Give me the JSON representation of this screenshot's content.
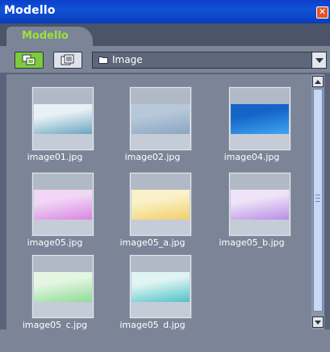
{
  "window": {
    "title": "Modello",
    "close_glyph": "✕"
  },
  "tab": {
    "label": "Modello"
  },
  "toolbar": {
    "view_thumbnails_icon": "thumbnail-view-icon",
    "view_list_icon": "film-view-icon",
    "folder": {
      "icon": "folder-icon",
      "label": "Image"
    }
  },
  "items": [
    {
      "name": "image01.jpg",
      "colors": [
        "#e8f1f5",
        "#6aa6bf"
      ]
    },
    {
      "name": "image02.jpg",
      "colors": [
        "#b7c8da",
        "#8ba6c3"
      ]
    },
    {
      "name": "image04.jpg",
      "colors": [
        "#1565c8",
        "#3fa6ee"
      ]
    },
    {
      "name": "image05.jpg",
      "colors": [
        "#f1d7f5",
        "#d886e3"
      ]
    },
    {
      "name": "image05_a.jpg",
      "colors": [
        "#fbf1c9",
        "#f0d06a"
      ]
    },
    {
      "name": "image05_b.jpg",
      "colors": [
        "#eee3f7",
        "#b88ee6"
      ]
    },
    {
      "name": "image05_c.jpg",
      "colors": [
        "#e4f6e2",
        "#8fdb96"
      ]
    },
    {
      "name": "image05_d.jpg",
      "colors": [
        "#dff4f3",
        "#4fc3c5"
      ]
    }
  ],
  "colors": {
    "accent_green": "#7dcb3c",
    "tab_text": "#9ee03c",
    "titlebar": "#0b3fc9"
  }
}
